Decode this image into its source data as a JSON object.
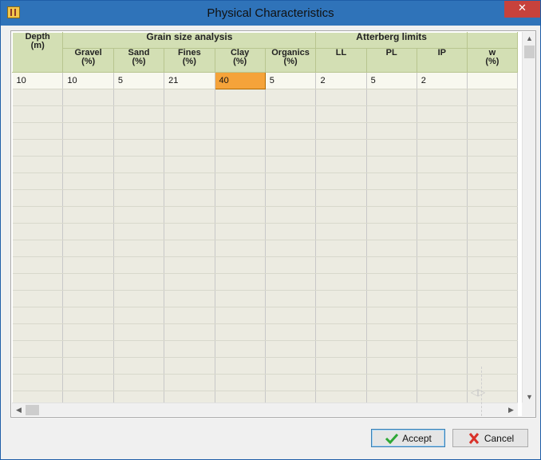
{
  "window": {
    "title": "Physical Characteristics",
    "close_glyph": "✕"
  },
  "grid": {
    "headers": {
      "depth": [
        "Depth",
        "(m)"
      ],
      "grain_group": "Grain size analysis",
      "atterberg_group": "Atterberg limits",
      "columns": [
        {
          "name": "Gravel",
          "unit": "(%)"
        },
        {
          "name": "Sand",
          "unit": "(%)"
        },
        {
          "name": "Fines",
          "unit": "(%)"
        },
        {
          "name": "Clay",
          "unit": "(%)"
        },
        {
          "name": "Organics",
          "unit": "(%)"
        },
        {
          "name": "LL",
          "unit": ""
        },
        {
          "name": "PL",
          "unit": ""
        },
        {
          "name": "IP",
          "unit": ""
        },
        {
          "name": "w",
          "unit": "(%)"
        }
      ]
    },
    "rows": [
      [
        "10",
        "10",
        "5",
        "21",
        "40",
        "5",
        "2",
        "5",
        "2",
        ""
      ]
    ],
    "active_cell": {
      "row": 0,
      "col": 4
    },
    "empty_row_count": 19
  },
  "scroll": {
    "up": "▲",
    "down": "▼",
    "left": "◀",
    "right": "▶"
  },
  "buttons": {
    "accept": "Accept",
    "cancel": "Cancel"
  },
  "colors": {
    "header_bg": "#d3dfb4",
    "active_cell": "#f5a33a",
    "accept_icon": "#2ea836",
    "cancel_icon": "#d9322a"
  }
}
